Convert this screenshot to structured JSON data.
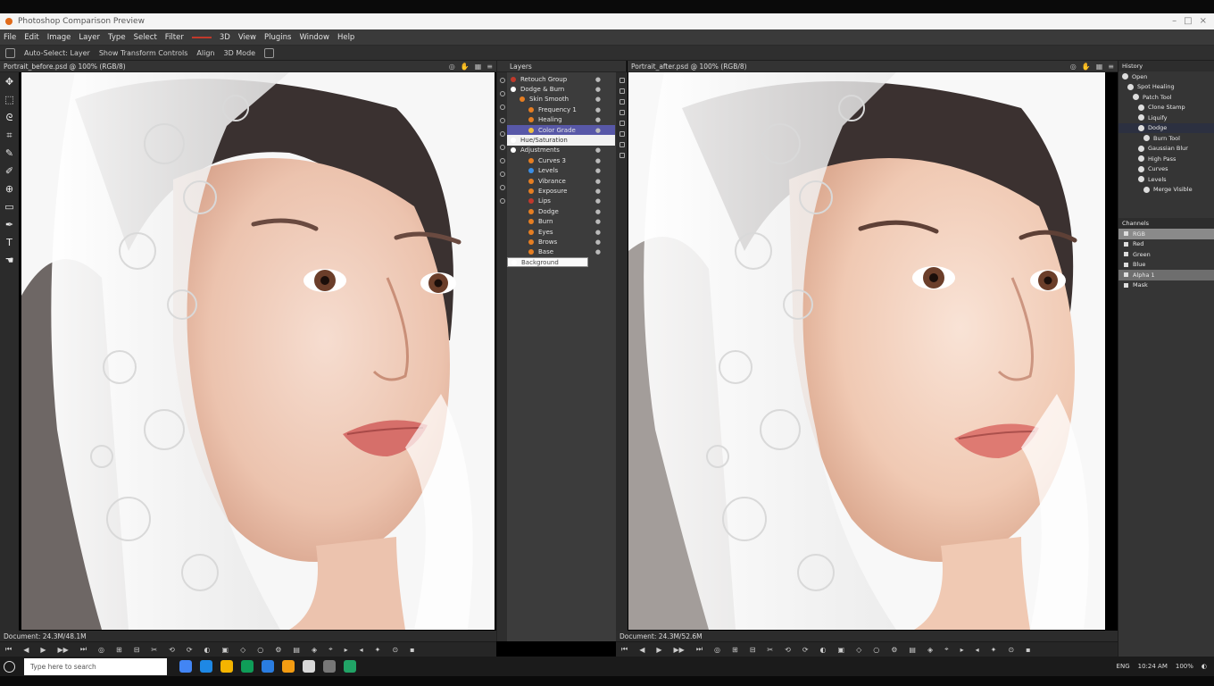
{
  "window": {
    "title": "Photoshop Comparison Preview",
    "controls": [
      "–",
      "□",
      "×"
    ]
  },
  "menu": [
    "File",
    "Edit",
    "Image",
    "Layer",
    "Type",
    "Select",
    "Filter",
    "3D",
    "View",
    "Plugins",
    "Window",
    "Help"
  ],
  "options_bar": [
    "Auto-Select: Layer",
    "Show Transform Controls",
    "Align",
    "3D Mode"
  ],
  "documents": {
    "left": {
      "tab": "Portrait_before.psd @ 100% (RGB/8)",
      "status": "Document: 24.3M/48.1M"
    },
    "right": {
      "tab": "Portrait_after.psd @ 100% (RGB/8)",
      "status": "Document: 24.3M/52.6M"
    }
  },
  "tools": [
    "move-tool",
    "marquee-tool",
    "lasso-tool",
    "crop-tool",
    "eyedropper-tool",
    "brush-tool",
    "clone-tool",
    "eraser-tool",
    "pen-tool",
    "type-tool",
    "hand-tool"
  ],
  "layers_panel": {
    "title": "Layers",
    "rows": [
      {
        "label": "Retouch Group",
        "color": "#c0392b",
        "indent": 0
      },
      {
        "label": "Dodge & Burn",
        "color": "#ffffff",
        "indent": 0
      },
      {
        "label": "Skin Smooth",
        "color": "#e67e22",
        "indent": 1
      },
      {
        "label": "Frequency 1",
        "color": "#e67e22",
        "indent": 2
      },
      {
        "label": "Healing",
        "color": "#e67e22",
        "indent": 2
      },
      {
        "label": "Color Grade",
        "color": "#f0c040",
        "indent": 2,
        "selected": true
      },
      {
        "label": "Hue/Saturation",
        "color": "#ffffff",
        "indent": 0,
        "white": true
      },
      {
        "label": "Adjustments",
        "color": "#ffffff",
        "indent": 0
      },
      {
        "label": "Curves 3",
        "color": "#e67e22",
        "indent": 2
      },
      {
        "label": "Levels",
        "color": "#3a8ee6",
        "indent": 2
      },
      {
        "label": "Vibrance",
        "color": "#e67e22",
        "indent": 2
      },
      {
        "label": "Exposure",
        "color": "#e67e22",
        "indent": 2
      },
      {
        "label": "Lips",
        "color": "#c0392b",
        "indent": 2
      },
      {
        "label": "Dodge",
        "color": "#e67e22",
        "indent": 2
      },
      {
        "label": "Burn",
        "color": "#e67e22",
        "indent": 2
      },
      {
        "label": "Eyes",
        "color": "#e67e22",
        "indent": 2
      },
      {
        "label": "Brows",
        "color": "#e67e22",
        "indent": 2
      },
      {
        "label": "Base",
        "color": "#e67e22",
        "indent": 2
      },
      {
        "label": "Background",
        "color": "#ffffff",
        "indent": 0,
        "input": true
      }
    ]
  },
  "history_panel": {
    "title": "History",
    "rows": [
      {
        "label": "Open",
        "indent": 0
      },
      {
        "label": "Spot Healing",
        "indent": 1
      },
      {
        "label": "Patch Tool",
        "indent": 2
      },
      {
        "label": "Clone Stamp",
        "indent": 3
      },
      {
        "label": "Liquify",
        "indent": 3
      },
      {
        "label": "Dodge",
        "indent": 3,
        "selected": true
      },
      {
        "label": "Burn Tool",
        "indent": 4
      },
      {
        "label": "Gaussian Blur",
        "indent": 3
      },
      {
        "label": "High Pass",
        "indent": 3
      },
      {
        "label": "Curves",
        "indent": 3
      },
      {
        "label": "Levels",
        "indent": 3
      },
      {
        "label": "Merge Visible",
        "indent": 4
      }
    ]
  },
  "channels_panel": {
    "title": "Channels",
    "rows": [
      {
        "label": "RGB",
        "style": "hl"
      },
      {
        "label": "Red",
        "style": ""
      },
      {
        "label": "Green",
        "style": ""
      },
      {
        "label": "Blue",
        "style": ""
      },
      {
        "label": "Alpha 1",
        "style": "hl2"
      },
      {
        "label": "Mask",
        "style": ""
      }
    ]
  },
  "taskbar": {
    "search_placeholder": "Type here to search",
    "apps": [
      {
        "name": "chrome",
        "color": "#4285f4"
      },
      {
        "name": "photoshop",
        "color": "#1e88e5"
      },
      {
        "name": "explorer",
        "color": "#f4b400"
      },
      {
        "name": "edge",
        "color": "#0f9d58"
      },
      {
        "name": "mail",
        "color": "#2a7de1"
      },
      {
        "name": "store",
        "color": "#f39c12"
      },
      {
        "name": "notes",
        "color": "#d8d8d8"
      },
      {
        "name": "calc",
        "color": "#777777"
      },
      {
        "name": "excel",
        "color": "#21a366"
      }
    ],
    "tray": [
      "ENG",
      "10:24 AM",
      "100%"
    ]
  }
}
